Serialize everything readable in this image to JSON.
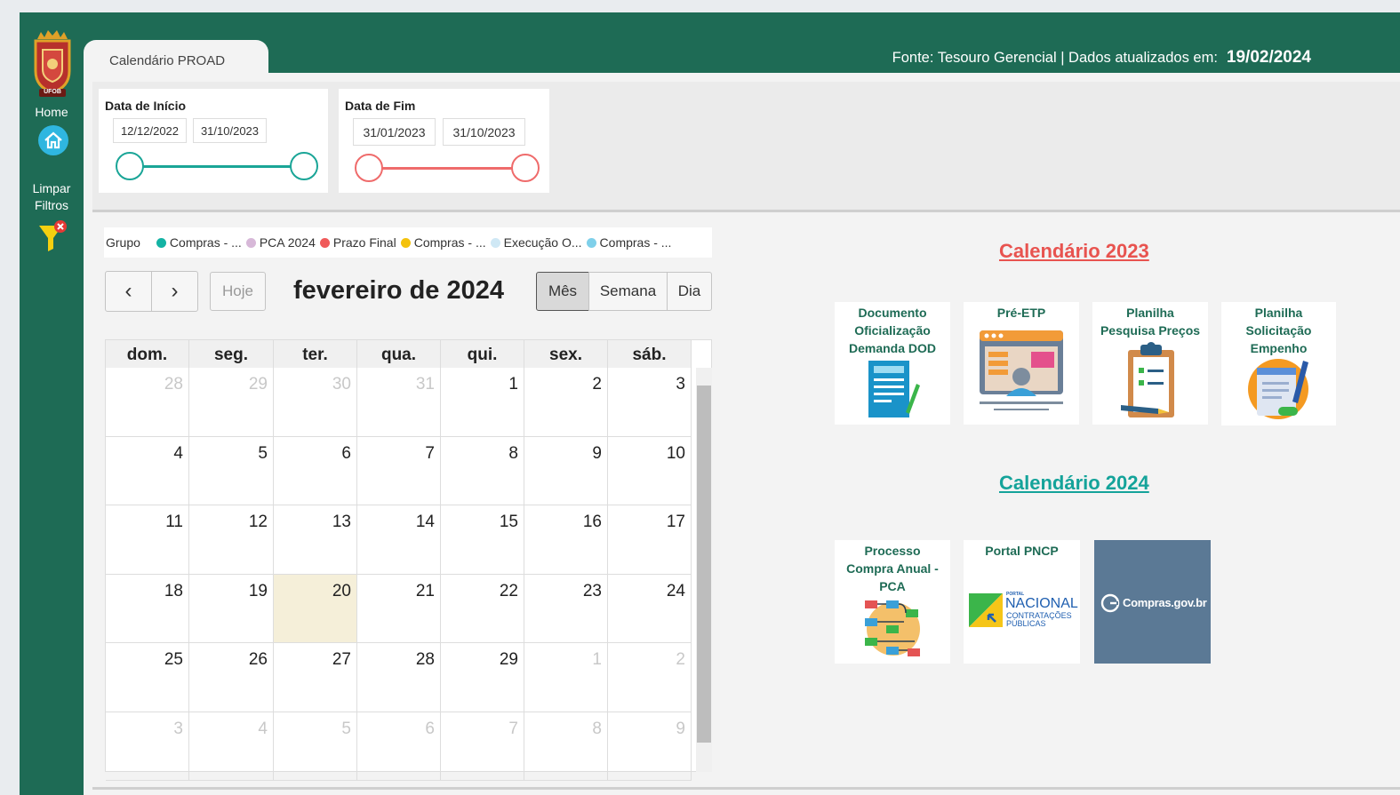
{
  "sidebar": {
    "logo_text": "UFOB",
    "home_label": "Home",
    "clear_filters_label_1": "Limpar",
    "clear_filters_label_2": "Filtros"
  },
  "header": {
    "tab_label": "Calendário PROAD",
    "source_text": "Fonte: Tesouro Gerencial | Dados atualizados em:",
    "updated_date": "19/02/2024"
  },
  "filters": {
    "start": {
      "title": "Data de Início",
      "from": "12/12/2022",
      "to": "31/10/2023",
      "color": "#1aa597"
    },
    "end": {
      "title": "Data de Fim",
      "from": "31/01/2023",
      "to": "31/10/2023",
      "color": "#ef6b6b"
    }
  },
  "legend": {
    "title": "Grupo",
    "items": [
      {
        "label": "Compras - ...",
        "color": "#14b3a4"
      },
      {
        "label": "PCA 2024",
        "color": "#d7b8d8"
      },
      {
        "label": "Prazo Final",
        "color": "#f05a5a"
      },
      {
        "label": "Compras - ...",
        "color": "#f4c20d"
      },
      {
        "label": "Execução O...",
        "color": "#cfe8f5"
      },
      {
        "label": "Compras - ...",
        "color": "#7fd0ea"
      }
    ]
  },
  "calendar": {
    "prev": "‹",
    "next": "›",
    "today_label": "Hoje",
    "title": "fevereiro de 2024",
    "views": [
      "Mês",
      "Semana",
      "Dia"
    ],
    "active_view": "Mês",
    "weekdays": [
      "dom.",
      "seg.",
      "ter.",
      "qua.",
      "qui.",
      "sex.",
      "sáb."
    ],
    "weeks": [
      [
        "28",
        "29",
        "30",
        "31",
        "1",
        "2",
        "3"
      ],
      [
        "4",
        "5",
        "6",
        "7",
        "8",
        "9",
        "10"
      ],
      [
        "11",
        "12",
        "13",
        "14",
        "15",
        "16",
        "17"
      ],
      [
        "18",
        "19",
        "20",
        "21",
        "22",
        "23",
        "24"
      ],
      [
        "25",
        "26",
        "27",
        "28",
        "29",
        "1",
        "2"
      ],
      [
        "3",
        "4",
        "5",
        "6",
        "7",
        "8",
        "9"
      ]
    ],
    "today": "20"
  },
  "links_2023": {
    "title": "Calendário 2023",
    "title_color": "#e8534f",
    "cards": [
      {
        "line1": "Documento",
        "line2": "Oficialização",
        "line3": "Demanda DOD",
        "icon": "document-icon"
      },
      {
        "line1": "Pré-ETP",
        "line2": "",
        "line3": "",
        "icon": "presentation-icon"
      },
      {
        "line1": "Planilha",
        "line2": "Pesquisa Preços",
        "line3": "",
        "icon": "clipboard-icon"
      },
      {
        "line1": "Planilha",
        "line2": "Solicitação",
        "line3": "Empenho",
        "icon": "form-pen-icon"
      }
    ]
  },
  "links_2024": {
    "title": "Calendário 2024",
    "title_color": "#14a39a",
    "cards": [
      {
        "line1": "Processo",
        "line2": "Compra Anual -",
        "line3": "PCA",
        "icon": "flowchart-icon"
      },
      {
        "line1": "Portal PNCP",
        "line2": "",
        "line3": "",
        "icon": "pncp-logo"
      },
      {
        "line1": "Compras.gov.br",
        "line2": "",
        "line3": "",
        "icon": "compras-gov-logo"
      }
    ],
    "pncp_small": "PORTAL",
    "pncp_big": "NACIONAL",
    "pncp_sub1": "CONTRATAÇÕES",
    "pncp_sub2": "PÚBLICAS"
  }
}
